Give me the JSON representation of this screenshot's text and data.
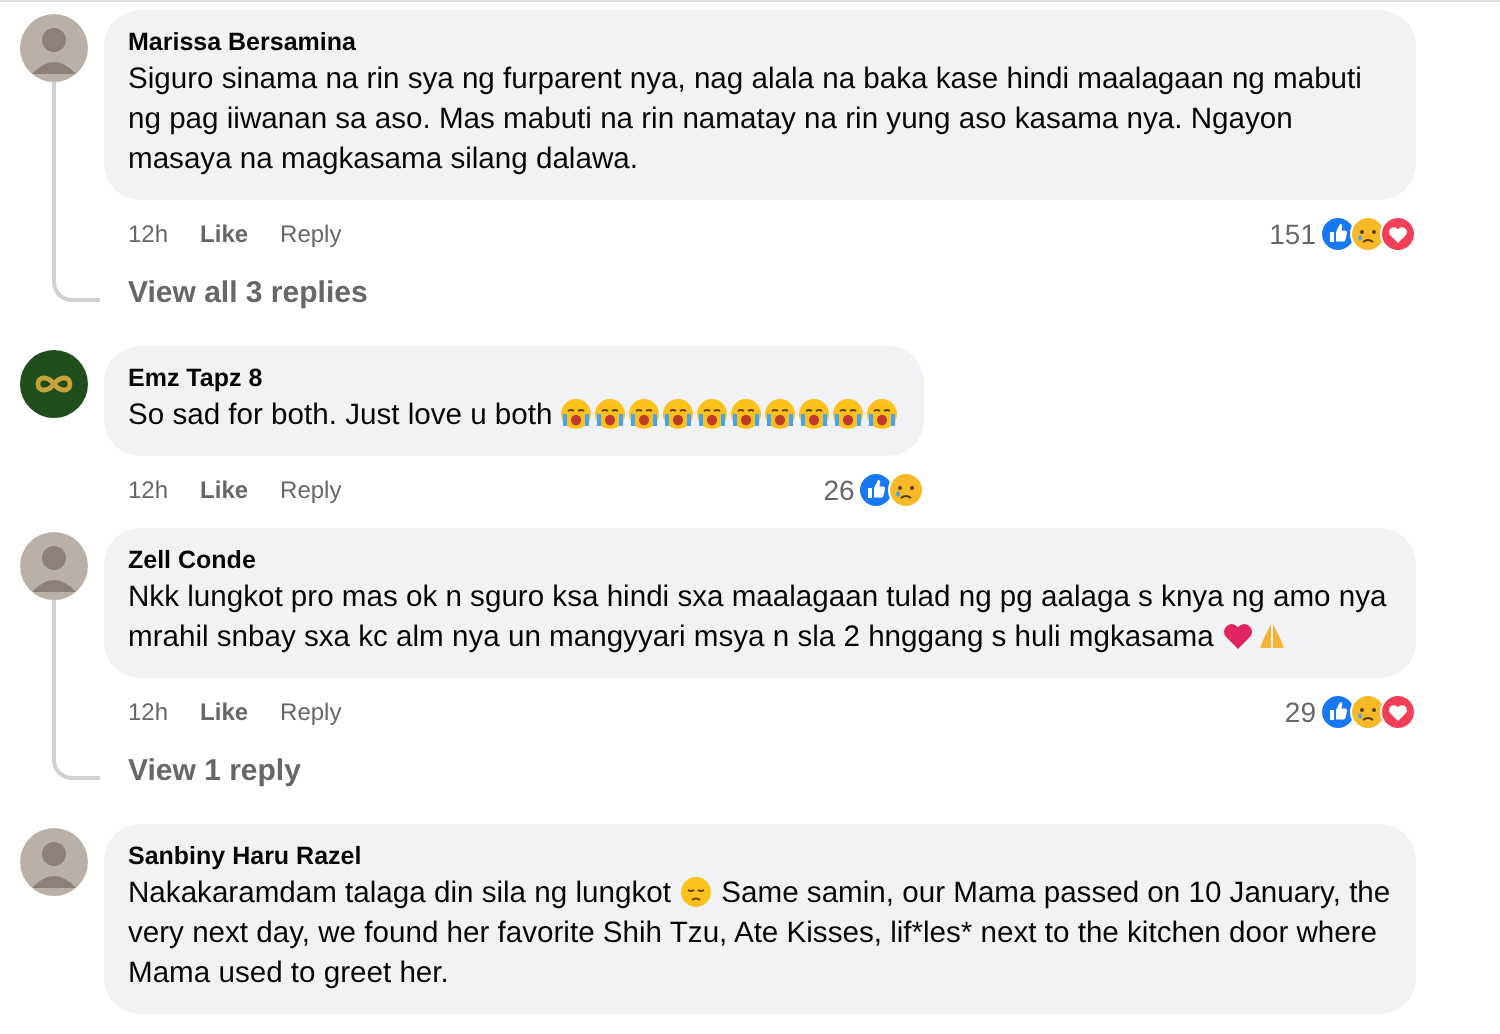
{
  "comments": [
    {
      "author": "Marissa Bersamina",
      "avatar": {
        "kind": "photo"
      },
      "body": [
        {
          "kind": "text",
          "text": "Siguro sinama na rin sya ng furparent nya, nag alala na baka kase hindi maalagaan ng mabuti ng pag iiwanan sa aso. Mas mabuti na rin namatay na rin yung aso kasama nya. Ngayon masaya na magkasama silang dalawa."
        }
      ],
      "time": "12h",
      "like": "Like",
      "reply": "Reply",
      "reaction_count": "151",
      "reactions": [
        {
          "kind": "like"
        },
        {
          "kind": "sad"
        },
        {
          "kind": "love"
        }
      ],
      "replies_link": "View all 3 replies"
    },
    {
      "author": "Emz Tapz 8",
      "avatar": {
        "kind": "logo"
      },
      "body": [
        {
          "kind": "text",
          "text": "So sad for both. Just love u both "
        },
        {
          "kind": "crying"
        },
        {
          "kind": "crying"
        },
        {
          "kind": "crying"
        },
        {
          "kind": "crying"
        },
        {
          "kind": "crying"
        },
        {
          "kind": "crying"
        },
        {
          "kind": "crying"
        },
        {
          "kind": "crying"
        },
        {
          "kind": "crying"
        },
        {
          "kind": "crying"
        }
      ],
      "time": "12h",
      "like": "Like",
      "reply": "Reply",
      "reaction_count": "26",
      "reactions": [
        {
          "kind": "like"
        },
        {
          "kind": "sad"
        }
      ]
    },
    {
      "author": "Zell Conde",
      "avatar": {
        "kind": "photo"
      },
      "body": [
        {
          "kind": "text",
          "text": "Nkk lungkot pro mas ok n sguro ksa hindi sxa maalagaan tulad ng pg aalaga s knya ng amo nya mrahil snbay sxa kc alm nya un mangyyari msya n sla 2 hnggang s huli mgkasama "
        },
        {
          "kind": "heart"
        },
        {
          "kind": "pray"
        }
      ],
      "time": "12h",
      "like": "Like",
      "reply": "Reply",
      "reaction_count": "29",
      "reactions": [
        {
          "kind": "like"
        },
        {
          "kind": "sad"
        },
        {
          "kind": "love"
        }
      ],
      "replies_link": "View 1 reply"
    },
    {
      "author": "Sanbiny Haru Razel",
      "avatar": {
        "kind": "photo"
      },
      "body": [
        {
          "kind": "text",
          "text": "Nakakaramdam talaga din sila ng lungkot "
        },
        {
          "kind": "pensive"
        },
        {
          "kind": "text",
          "text": " Same samin, our Mama passed on 10 January, the very next day, we found her favorite Shih Tzu, Ate Kisses, lif*les* next to the kitchen door where Mama used to greet her."
        }
      ]
    }
  ]
}
